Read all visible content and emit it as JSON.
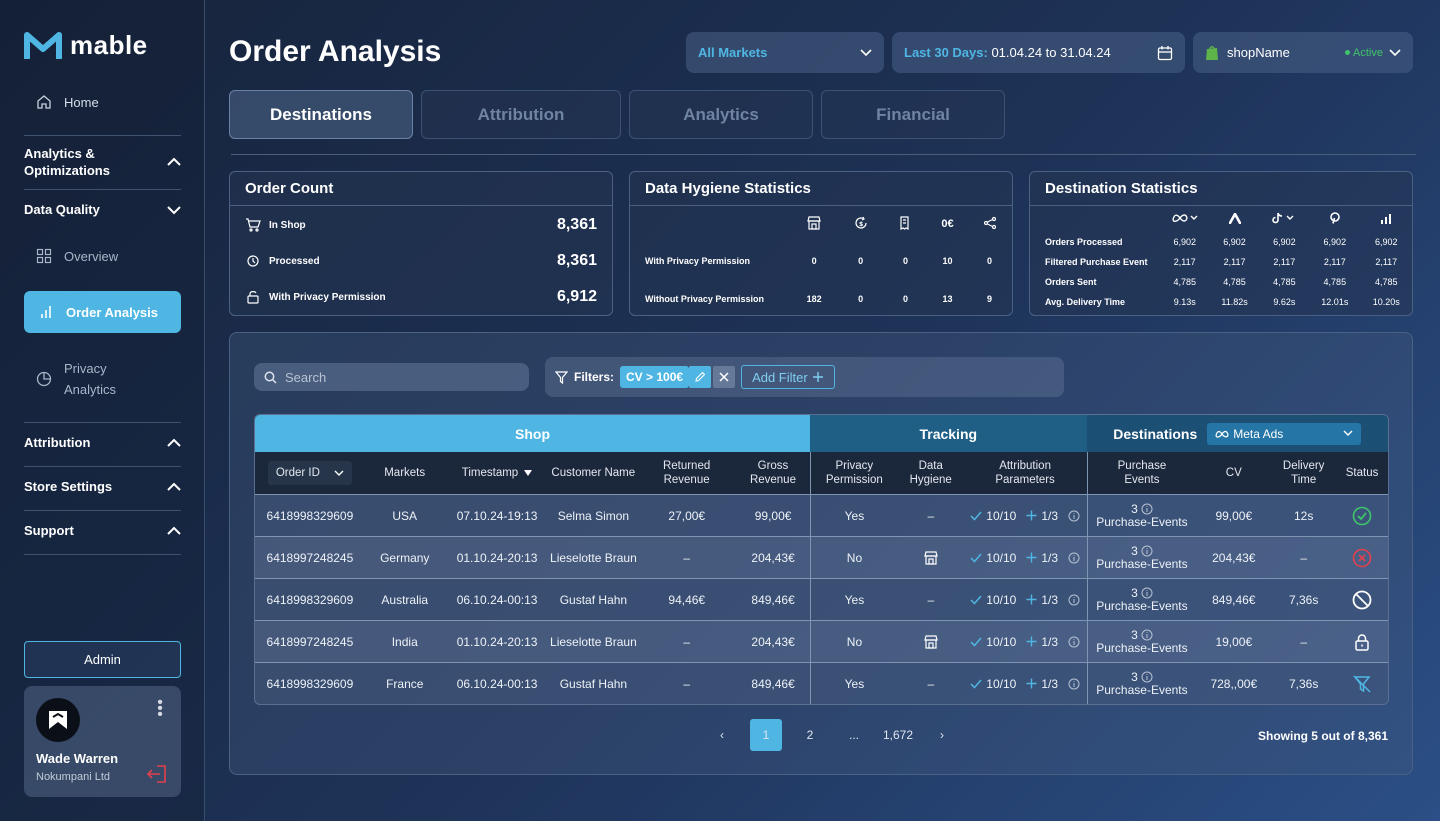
{
  "app": {
    "name": "mable"
  },
  "sidebar": {
    "home": "Home",
    "sections": {
      "analytics": "Analytics & Optimizations",
      "data_quality": "Data Quality",
      "attribution": "Attribution",
      "store_settings": "Store Settings",
      "support": "Support"
    },
    "sub_items": {
      "overview": "Overview",
      "order_analysis": "Order Analysis",
      "privacy_analytics": "Privacy Analytics"
    },
    "admin_label": "Admin",
    "user": {
      "name": "Wade Warren",
      "company": "Nokumpani Ltd"
    }
  },
  "header": {
    "title": "Order Analysis",
    "market_select": "All Markets",
    "date_range_label": "Last 30 Days:",
    "date_range_value": "01.04.24 to 31.04.24",
    "shop_name": "shopName",
    "shop_status": "Active"
  },
  "tabs": [
    "Destinations",
    "Attribution",
    "Analytics",
    "Financial"
  ],
  "order_count": {
    "title": "Order Count",
    "rows": [
      {
        "label": "In Shop",
        "value": "8,361"
      },
      {
        "label": "Processed",
        "value": "8,361"
      },
      {
        "label": "With Privacy Permission",
        "value": "6,912"
      }
    ]
  },
  "data_hygiene": {
    "title": "Data Hygiene Statistics",
    "col_header_0€": "0€",
    "rows": [
      {
        "label": "With Privacy Permission",
        "values": [
          "0",
          "0",
          "0",
          "10",
          "0"
        ]
      },
      {
        "label": "Without Privacy Permission",
        "values": [
          "182",
          "0",
          "0",
          "13",
          "9"
        ]
      }
    ]
  },
  "destination_stats": {
    "title": "Destination Statistics",
    "rows": [
      {
        "label": "Orders Processed",
        "values": [
          "6,902",
          "6,902",
          "6,902",
          "6,902",
          "6,902"
        ]
      },
      {
        "label": "Filtered Purchase Event",
        "values": [
          "2,117",
          "2,117",
          "2,117",
          "2,117",
          "2,117"
        ]
      },
      {
        "label": "Orders Sent",
        "values": [
          "4,785",
          "4,785",
          "4,785",
          "4,785",
          "4,785"
        ]
      },
      {
        "label": "Avg. Delivery Time",
        "values": [
          "9.13s",
          "11.82s",
          "9.62s",
          "12.01s",
          "10.20s"
        ]
      }
    ]
  },
  "toolbar": {
    "search_placeholder": "Search",
    "filters_label": "Filters:",
    "filter_chip": "CV > 100€",
    "add_filter": "Add Filter"
  },
  "table": {
    "groups": {
      "shop": "Shop",
      "tracking": "Tracking",
      "destinations": "Destinations",
      "destination_select": "Meta Ads"
    },
    "columns": {
      "order_id": "Order ID",
      "markets": "Markets",
      "timestamp": "Timestamp",
      "customer": "Customer Name",
      "returned": "Returned Revenue",
      "gross": "Gross Revenue",
      "privacy": "Privacy Permission",
      "hygiene": "Data Hygiene",
      "attribution": "Attribution Parameters",
      "purchase": "Purchase Events",
      "cv": "CV",
      "delivery": "Delivery Time",
      "status": "Status"
    },
    "rows": [
      {
        "id": "6418998329609",
        "market": "USA",
        "ts": "07.10.24-19:13",
        "customer": "Selma Simon",
        "returned": "27,00€",
        "gross": "99,00€",
        "privacy": "Yes",
        "hygiene": "–",
        "attr1": "10/10",
        "attr2": "1/3",
        "pe_count": "3",
        "pe_label": "Purchase-Events",
        "cv": "99,00€",
        "delivery": "12s",
        "status": "success"
      },
      {
        "id": "6418997248245",
        "market": "Germany",
        "ts": "01.10.24-20:13",
        "customer": "Lieselotte Braun",
        "returned": "–",
        "gross": "204,43€",
        "privacy": "No",
        "hygiene": "",
        "attr1": "10/10",
        "attr2": "1/3",
        "pe_count": "3",
        "pe_label": "Purchase-Events",
        "cv": "204,43€",
        "delivery": "–",
        "status": "error"
      },
      {
        "id": "6418998329609",
        "market": "Australia",
        "ts": "06.10.24-00:13",
        "customer": "Gustaf Hahn",
        "returned": "94,46€",
        "gross": "849,46€",
        "privacy": "Yes",
        "hygiene": "–",
        "attr1": "10/10",
        "attr2": "1/3",
        "pe_count": "3",
        "pe_label": "Purchase-Events",
        "cv": "849,46€",
        "delivery": "7,36s",
        "status": "blocked"
      },
      {
        "id": "6418997248245",
        "market": "India",
        "ts": "01.10.24-20:13",
        "customer": "Lieselotte Braun",
        "returned": "–",
        "gross": "204,43€",
        "privacy": "No",
        "hygiene": "",
        "attr1": "10/10",
        "attr2": "1/3",
        "pe_count": "3",
        "pe_label": "Purchase-Events",
        "cv": "19,00€",
        "delivery": "–",
        "status": "locked"
      },
      {
        "id": "6418998329609",
        "market": "France",
        "ts": "06.10.24-00:13",
        "customer": "Gustaf Hahn",
        "returned": "–",
        "gross": "849,46€",
        "privacy": "Yes",
        "hygiene": "–",
        "attr1": "10/10",
        "attr2": "1/3",
        "pe_count": "3",
        "pe_label": "Purchase-Events",
        "cv": "728,,00€",
        "delivery": "7,36s",
        "status": "filtered"
      }
    ]
  },
  "pagination": {
    "prev": "‹",
    "pages": [
      "1",
      "2",
      "...",
      "1,672"
    ],
    "next": "›",
    "showing": "Showing 5 out of 8,361"
  },
  "colors": {
    "accent": "#4fb6e3",
    "tracking": "#1f5f86",
    "success": "#3fc46a",
    "error": "#e0414f"
  }
}
